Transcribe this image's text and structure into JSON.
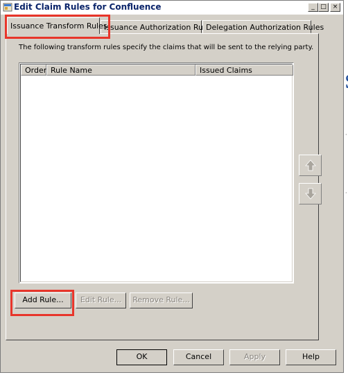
{
  "window": {
    "title": "Edit Claim Rules for Confluence",
    "controls": {
      "minimize": "_",
      "maximize": "□",
      "close": "×"
    }
  },
  "tabs": [
    {
      "label": "Issuance Transform Rules",
      "active": true
    },
    {
      "label": "Issuance Authorization Rules",
      "active": false
    },
    {
      "label": "Delegation Authorization Rules",
      "active": false
    }
  ],
  "panel": {
    "description": "The following transform rules specify the claims that will be sent to the relying party.",
    "table": {
      "columns": [
        "Order",
        "Rule Name",
        "Issued Claims"
      ],
      "rows": []
    },
    "move_up_icon": "arrow-up-icon",
    "move_down_icon": "arrow-down-icon",
    "buttons": {
      "add_rule": "Add Rule...",
      "edit_rule": "Edit Rule...",
      "remove_rule": "Remove Rule..."
    }
  },
  "footer": {
    "ok": "OK",
    "cancel": "Cancel",
    "apply": "Apply",
    "help": "Help"
  },
  "background_fragments": {
    "letter": "S"
  },
  "colors": {
    "highlight": "#e8352a",
    "dialog_face": "#d4d0c8",
    "title_text": "#0a246a"
  }
}
